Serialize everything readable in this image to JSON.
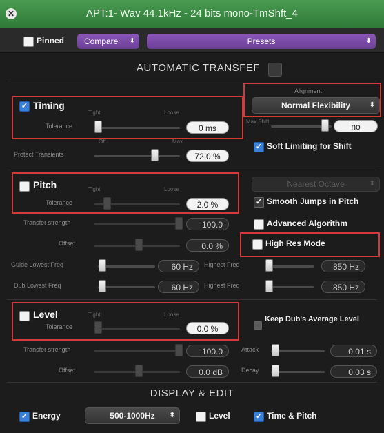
{
  "window": {
    "title": "APT:1- Wav 44.1kHz - 24 bits mono-TmShft_4"
  },
  "toolbar": {
    "pinned_label": "Pinned",
    "compare_label": "Compare",
    "presets_label": "Presets"
  },
  "automatic_transfer": {
    "label": "AUTOMATIC TRANSFEF"
  },
  "alignment": {
    "label": "Alignment",
    "value": "Normal Flexibility",
    "max_shift_label": "Max Shift",
    "max_shift_value": "no",
    "soft_limiting_label": "Soft Limiting for Shift"
  },
  "timing": {
    "label": "Timing",
    "tight_label": "Tight",
    "loose_label": "Loose",
    "tolerance_label": "Tolerance",
    "tolerance_value": "0 ms",
    "off_label": "Off",
    "max_label": "Max",
    "protect_label": "Protect Transients",
    "protect_value": "72.0 %"
  },
  "pitch": {
    "label": "Pitch",
    "tight_label": "Tight",
    "loose_label": "Loose",
    "tolerance_label": "Tolerance",
    "tolerance_value": "2.0 %",
    "nearest_label": "Nearest Octave",
    "smooth_label": "Smooth Jumps in Pitch",
    "transfer_label": "Transfer strength",
    "transfer_value": "100.0",
    "advanced_label": "Advanced Algorithm",
    "offset_label": "Offset",
    "offset_value": "0.0 %",
    "high_res_label": "High Res Mode",
    "guide_low_label": "Guide Lowest Freq",
    "guide_low_value": "60 Hz",
    "guide_high_label": "Highest Freq",
    "guide_high_value": "850 Hz",
    "dub_low_label": "Dub Lowest Freq",
    "dub_low_value": "60 Hz",
    "dub_high_label": "Highest Freq",
    "dub_high_value": "850 Hz"
  },
  "level": {
    "label": "Level",
    "tight_label": "Tight",
    "loose_label": "Loose",
    "tolerance_label": "Tolerance",
    "tolerance_value": "0.0 %",
    "keep_label": "Keep Dub's Average Level",
    "transfer_label": "Transfer strength",
    "transfer_value": "100.0",
    "attack_label": "Attack",
    "attack_value": "0.01 s",
    "offset_label": "Offset",
    "offset_value": "0.0 dB",
    "decay_label": "Decay",
    "decay_value": "0.03 s"
  },
  "display": {
    "title": "DISPLAY & EDIT",
    "energy_label": "Energy",
    "band_value": "500-1000Hz",
    "level_label": "Level",
    "time_pitch_label": "Time & Pitch"
  },
  "colors": {
    "accent": "#3a7fd8",
    "highlight": "#d43a3a",
    "titlebar": "#3d8c45",
    "popup": "#7a4ca8"
  }
}
